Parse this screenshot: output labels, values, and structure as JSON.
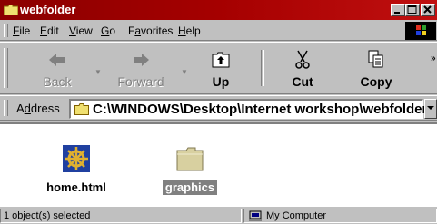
{
  "window": {
    "title": "webfolder",
    "caption_buttons": [
      "minimize",
      "maximize",
      "close"
    ]
  },
  "menu": {
    "items": [
      {
        "label": "File",
        "accel": "F"
      },
      {
        "label": "Edit",
        "accel": "E"
      },
      {
        "label": "View",
        "accel": "V"
      },
      {
        "label": "Go",
        "accel": "G"
      },
      {
        "label": "Favorites",
        "accel": "a"
      },
      {
        "label": "Help",
        "accel": "H"
      }
    ]
  },
  "toolbar": {
    "back": {
      "label": "Back",
      "icon": "back-arrow-icon",
      "enabled": false
    },
    "forward": {
      "label": "Forward",
      "icon": "forward-arrow-icon",
      "enabled": false
    },
    "up": {
      "label": "Up",
      "icon": "up-folder-icon",
      "enabled": true
    },
    "cut": {
      "label": "Cut",
      "icon": "scissors-icon",
      "enabled": true
    },
    "copy": {
      "label": "Copy",
      "icon": "copy-icon",
      "enabled": true
    }
  },
  "address": {
    "label": "Address",
    "value": "C:\\WINDOWS\\Desktop\\Internet workshop\\webfolder"
  },
  "files": [
    {
      "name": "home.html",
      "icon": "ship-wheel-html-icon",
      "selected": false
    },
    {
      "name": "graphics",
      "icon": "folder-icon",
      "selected": true
    }
  ],
  "status": {
    "selection": "1 object(s) selected",
    "zone": "My Computer"
  },
  "colors": {
    "title_bar": "#a50000",
    "face": "#c0c0c0",
    "folder": "#d8d0a0"
  }
}
